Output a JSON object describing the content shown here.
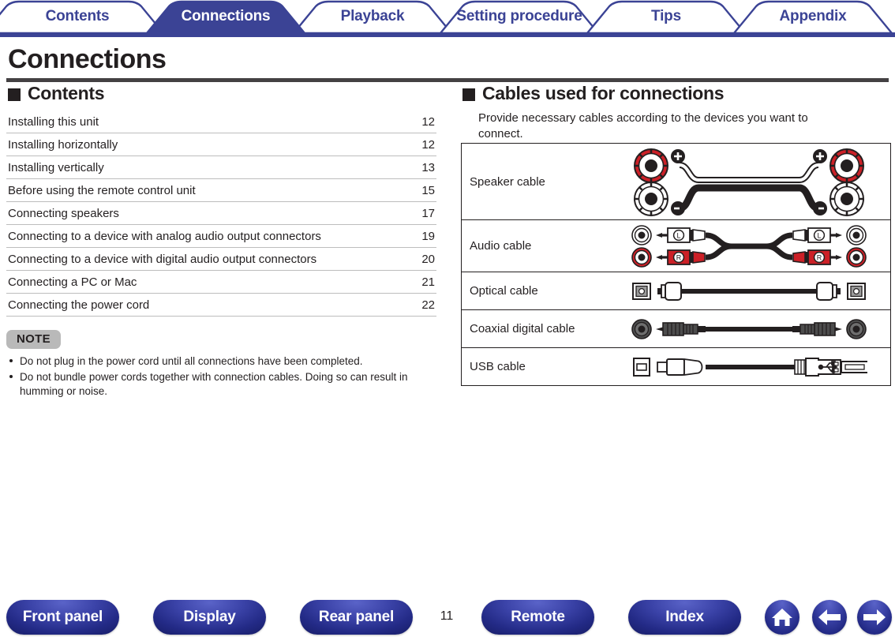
{
  "tabs": [
    {
      "label": "Contents",
      "active": false
    },
    {
      "label": "Connections",
      "active": true
    },
    {
      "label": "Playback",
      "active": false
    },
    {
      "label": "Setting procedure",
      "active": false
    },
    {
      "label": "Tips",
      "active": false
    },
    {
      "label": "Appendix",
      "active": false
    }
  ],
  "page": {
    "title": "Connections",
    "number": "11"
  },
  "left": {
    "section_heading": "Contents",
    "toc": [
      {
        "title": "Installing this unit",
        "page": "12"
      },
      {
        "title": "Installing horizontally",
        "page": "12"
      },
      {
        "title": "Installing vertically",
        "page": "13"
      },
      {
        "title": "Before using the remote control unit",
        "page": "15"
      },
      {
        "title": "Connecting speakers",
        "page": "17"
      },
      {
        "title": "Connecting to a device with analog audio output connectors",
        "page": "19"
      },
      {
        "title": "Connecting to a device with digital audio output connectors",
        "page": "20"
      },
      {
        "title": "Connecting a PC or Mac",
        "page": "21"
      },
      {
        "title": "Connecting the power cord",
        "page": "22"
      }
    ],
    "note": {
      "badge": "NOTE",
      "items": [
        "Do not plug in the power cord until all connections have been completed.",
        "Do not bundle power cords together with connection cables. Doing so can result in humming or noise."
      ]
    }
  },
  "right": {
    "section_heading": "Cables used for connections",
    "intro": "Provide necessary cables according to the devices you want to connect.",
    "cables": [
      {
        "name": "Speaker cable",
        "art": "speaker-cable-diagram"
      },
      {
        "name": "Audio cable",
        "art": "rca-audio-cable-diagram"
      },
      {
        "name": "Optical cable",
        "art": "optical-toslink-cable-diagram"
      },
      {
        "name": "Coaxial digital cable",
        "art": "coaxial-digital-cable-diagram"
      },
      {
        "name": "USB cable",
        "art": "usb-cable-diagram"
      }
    ]
  },
  "bottom_nav": {
    "buttons": [
      {
        "label": "Front panel"
      },
      {
        "label": "Display"
      },
      {
        "label": "Rear panel"
      },
      {
        "label": "Remote"
      },
      {
        "label": "Index"
      }
    ],
    "icons": [
      {
        "name": "home-icon"
      },
      {
        "name": "arrow-left-icon"
      },
      {
        "name": "arrow-right-icon"
      }
    ]
  },
  "colors": {
    "tab_blue": "#3b4395",
    "active_tab": "#3b4395",
    "rule_dark": "#444143",
    "note_badge_gray": "#b9b9b9",
    "accent_red": "#cc2027"
  }
}
